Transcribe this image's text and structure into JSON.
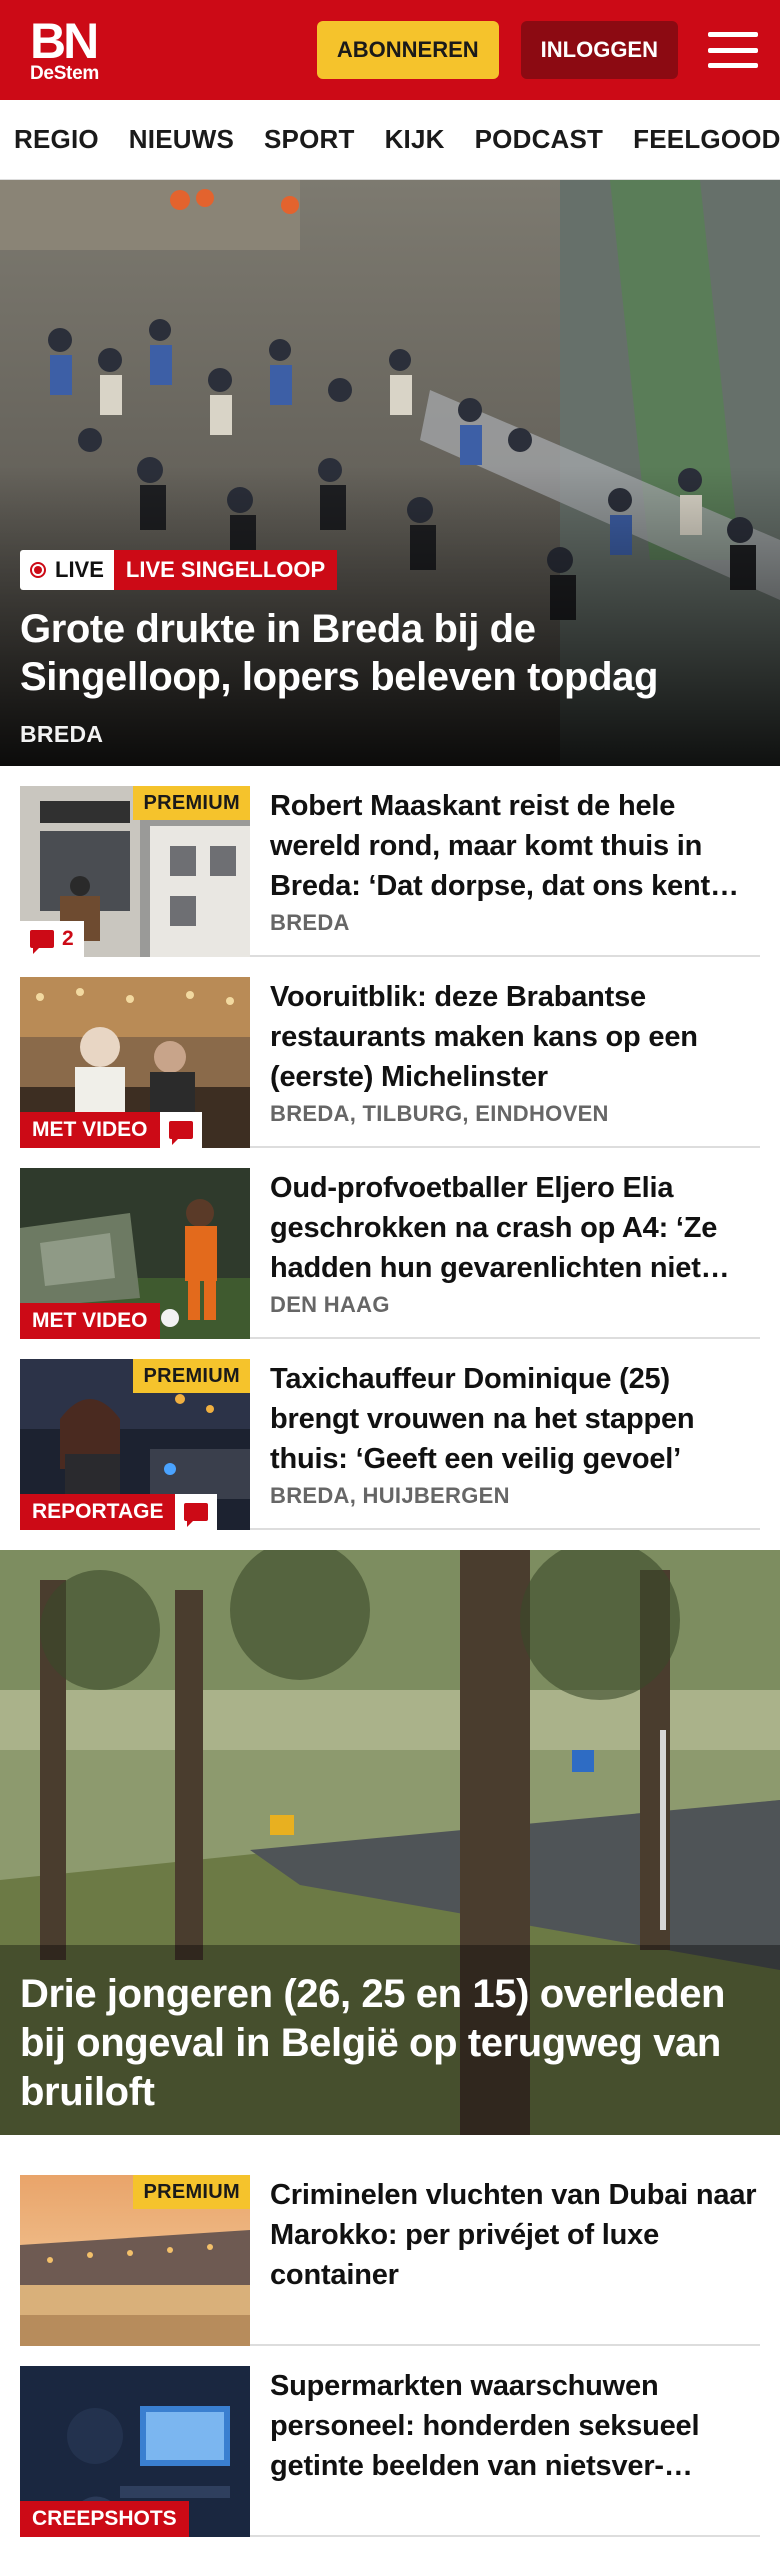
{
  "header": {
    "logo_main": "BN",
    "logo_sub": "DeStem",
    "subscribe_label": "ABONNEREN",
    "login_label": "INLOGGEN",
    "menu_icon": "hamburger-menu-icon"
  },
  "nav": {
    "items": [
      "REGIO",
      "NIEUWS",
      "SPORT",
      "KIJK",
      "PODCAST",
      "FEELGOOD"
    ]
  },
  "hero": {
    "live_label": "LIVE",
    "tag_label": "LIVE SINGELLOOP",
    "title": "Grote drukte in Breda bij de Singelloop, lopers beleven topdag",
    "location": "BREDA"
  },
  "articles": [
    {
      "title": "Robert Maaskant reist de hele wereld rond, maar komt thuis in Breda: ‘Dat dorpse, dat ons kent…",
      "location": "BREDA",
      "premium": "PREMIUM",
      "comments": "2"
    },
    {
      "title": "Vooruitblik: deze Brabantse restaurants maken kans op een (eerste) Michelinster",
      "location": "BREDA, TILBURG, EINDHOVEN",
      "tag": "MET VIDEO"
    },
    {
      "title": "Oud-profvoetballer Eljero Elia geschrokken na crash op A4: ‘Ze hadden hun gevarenlichten niet…",
      "location": "DEN HAAG",
      "tag": "MET VIDEO"
    },
    {
      "title": "Taxichauffeur Dominique (25) brengt vrouwen na het stappen thuis: ‘Geeft een veilig gevoel’",
      "location": "BREDA, HUIJBERGEN",
      "premium": "PREMIUM",
      "tag": "REPORTAGE"
    }
  ],
  "big_story": {
    "title": "Drie jongeren (26, 25 en 15) overleden bij ongeval in België op terugweg van bruiloft"
  },
  "articles2": [
    {
      "title": "Criminelen vluchten van Dubai naar Marokko: per privéjet of luxe container",
      "premium": "PREMIUM"
    },
    {
      "title": "Supermarkten waarschuwen personeel: honderden seksueel getinte beelden van nietsver-…",
      "tag": "CREEPSHOTS"
    }
  ]
}
